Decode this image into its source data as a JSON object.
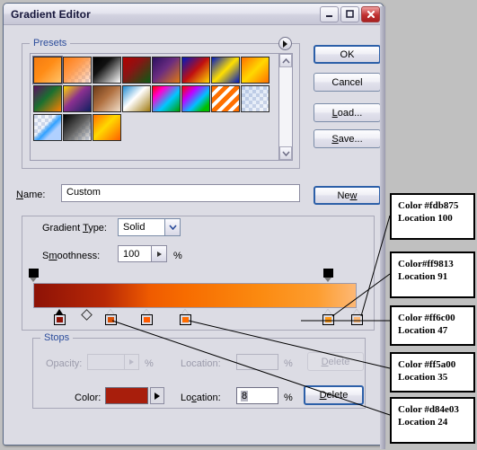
{
  "window": {
    "title": "Gradient Editor",
    "controls": [
      {
        "name": "minimize",
        "glyph": "minimize-icon"
      },
      {
        "name": "maximize",
        "glyph": "maximize-icon"
      },
      {
        "name": "close",
        "glyph": "close-icon"
      }
    ]
  },
  "presets": {
    "legend": "Presets",
    "menu_icon": "right-triangle-icon",
    "scroll_up_icon": "chevron-up-icon",
    "scroll_down_icon": "chevron-down-icon",
    "swatches": [
      {
        "id": "preset-1",
        "css": "linear-gradient(135deg,#f47b10 0%,#ff8c16 45%,#ffc46b 100%)",
        "selected": true
      },
      {
        "id": "preset-2",
        "css": "linear-gradient(135deg,#ff7b10 0%,#ff9a4a 40%,rgba(255,160,120,0.25) 100%)"
      },
      {
        "id": "preset-3",
        "css": "linear-gradient(135deg,#000000 0%,#111111 35%,#ffffff 100%)"
      },
      {
        "id": "preset-4",
        "css": "linear-gradient(135deg,#b50000 0%,#8a1414 40%,#0a5a14 100%)"
      },
      {
        "id": "preset-5",
        "css": "linear-gradient(135deg,#2b1060 0%,#6a2c80 45%,#e07a10 100%)"
      },
      {
        "id": "preset-6",
        "css": "linear-gradient(135deg,#0018c0 0%,#c01010 50%,#ffd800 100%)"
      },
      {
        "id": "preset-7",
        "css": "linear-gradient(135deg,#0018c0 0%,#ffe000 50%,#0018c0 100%)"
      },
      {
        "id": "preset-8",
        "css": "linear-gradient(135deg,#ff7000 0%,#ffd800 50%,#ff7000 100%)"
      },
      {
        "id": "preset-9",
        "css": "linear-gradient(135deg,#5c1060 0%,#1a7030 45%,#ff8000 100%)"
      },
      {
        "id": "preset-10",
        "css": "linear-gradient(135deg,#ffd800 0%,#8a3090 45%,#102060 100%)"
      },
      {
        "id": "preset-11",
        "css": "linear-gradient(135deg,#6b3a18 0%,#b07040 45%,#f0ddc8 100%)"
      },
      {
        "id": "preset-12",
        "css": "linear-gradient(135deg,#1f8ad0 0%,#ffffff 45%,#a07a10 100%)"
      },
      {
        "id": "preset-13",
        "css": "linear-gradient(135deg,#ff0000 0%,#ff00d0 25%,#00c8ff 60%,#00a000 100%)"
      },
      {
        "id": "preset-14",
        "css": "linear-gradient(135deg,#ff0000 0%,#c000ff 30%,#00c0ff 60%,#00c000 85%)"
      },
      {
        "id": "preset-15",
        "css": "repeating-linear-gradient(135deg,#ff7000 0 5px,#ffffff 5px 9px)"
      },
      {
        "id": "preset-16",
        "css": "linear-gradient(135deg,rgba(120,160,220,0.3),rgba(200,210,235,0.2))"
      },
      {
        "id": "preset-17",
        "css": "linear-gradient(135deg,rgba(200,210,235,0.25) 40%,#30a0ff 55%,#b0d0ff 70%)"
      },
      {
        "id": "preset-18",
        "css": "linear-gradient(135deg,#000000 0%,#606060 50%,rgba(200,200,200,0.25) 100%)"
      },
      {
        "id": "preset-19",
        "css": "linear-gradient(135deg,#ff7000 0%,#ffd800 45%,#ff6000 100%)"
      }
    ]
  },
  "buttons": {
    "ok": "OK",
    "cancel": "Cancel",
    "load": "Load...",
    "save": "Save...",
    "new": "New"
  },
  "name_row": {
    "label": "Name:",
    "value": "Custom"
  },
  "gradient": {
    "type_label": "Gradient Type:",
    "type_value": "Solid",
    "smoothness_label": "Smoothness:",
    "smoothness_value": "100",
    "percent": "%",
    "bar_css": "linear-gradient(to right,#8d1206 0%,#b82806 22%,#ef5b00 36%,#f76c00 47%,#fb8a10 70%,#fd9d2f 88%,#fdb875 100%)",
    "opacity_stops": [
      {
        "name": "opacity-stop-left",
        "location": 0
      },
      {
        "name": "opacity-stop-right",
        "location": 91
      }
    ],
    "midpoints": [
      {
        "name": "midpoint-marker",
        "location": 16
      }
    ],
    "color_stops": [
      {
        "name": "color-stop-selected",
        "location": 8,
        "color": "#8d1206",
        "selected": true
      },
      {
        "name": "color-stop-2",
        "location": 24,
        "color": "#d84e03"
      },
      {
        "name": "color-stop-3",
        "location": 35,
        "color": "#ff5a00"
      },
      {
        "name": "color-stop-4",
        "location": 47,
        "color": "#ff6c00"
      },
      {
        "name": "color-stop-5",
        "location": 91,
        "color": "#ff9813"
      },
      {
        "name": "color-stop-6",
        "location": 100,
        "color": "#fdb875"
      }
    ]
  },
  "stops": {
    "legend": "Stops",
    "opacity_label": "Opacity:",
    "opacity_value": "",
    "opacity_percent": "%",
    "location_label_top": "Location:",
    "location_value_top": "",
    "location_percent_top": "%",
    "delete_top": "Delete",
    "color_label": "Color:",
    "color_value": "#a81e0c",
    "color_arrow_icon": "right-triangle-icon",
    "location_label_bottom": "Location:",
    "location_value_bottom": "8",
    "location_percent_bottom": "%",
    "delete_bottom": "Delete"
  },
  "annotations": [
    {
      "name": "annotation-stop-100",
      "color_line": "Color #fdb875",
      "location_line": "Location 100"
    },
    {
      "name": "annotation-stop-91",
      "color_line": "Color#ff9813",
      "location_line": "Location 91"
    },
    {
      "name": "annotation-stop-47",
      "color_line": "Color #ff6c00",
      "location_line": "Location 47"
    },
    {
      "name": "annotation-stop-35",
      "color_line": "Color #ff5a00",
      "location_line": "Location 35"
    },
    {
      "name": "annotation-stop-24",
      "color_line": "Color #d84e03",
      "location_line": "Location 24"
    }
  ]
}
